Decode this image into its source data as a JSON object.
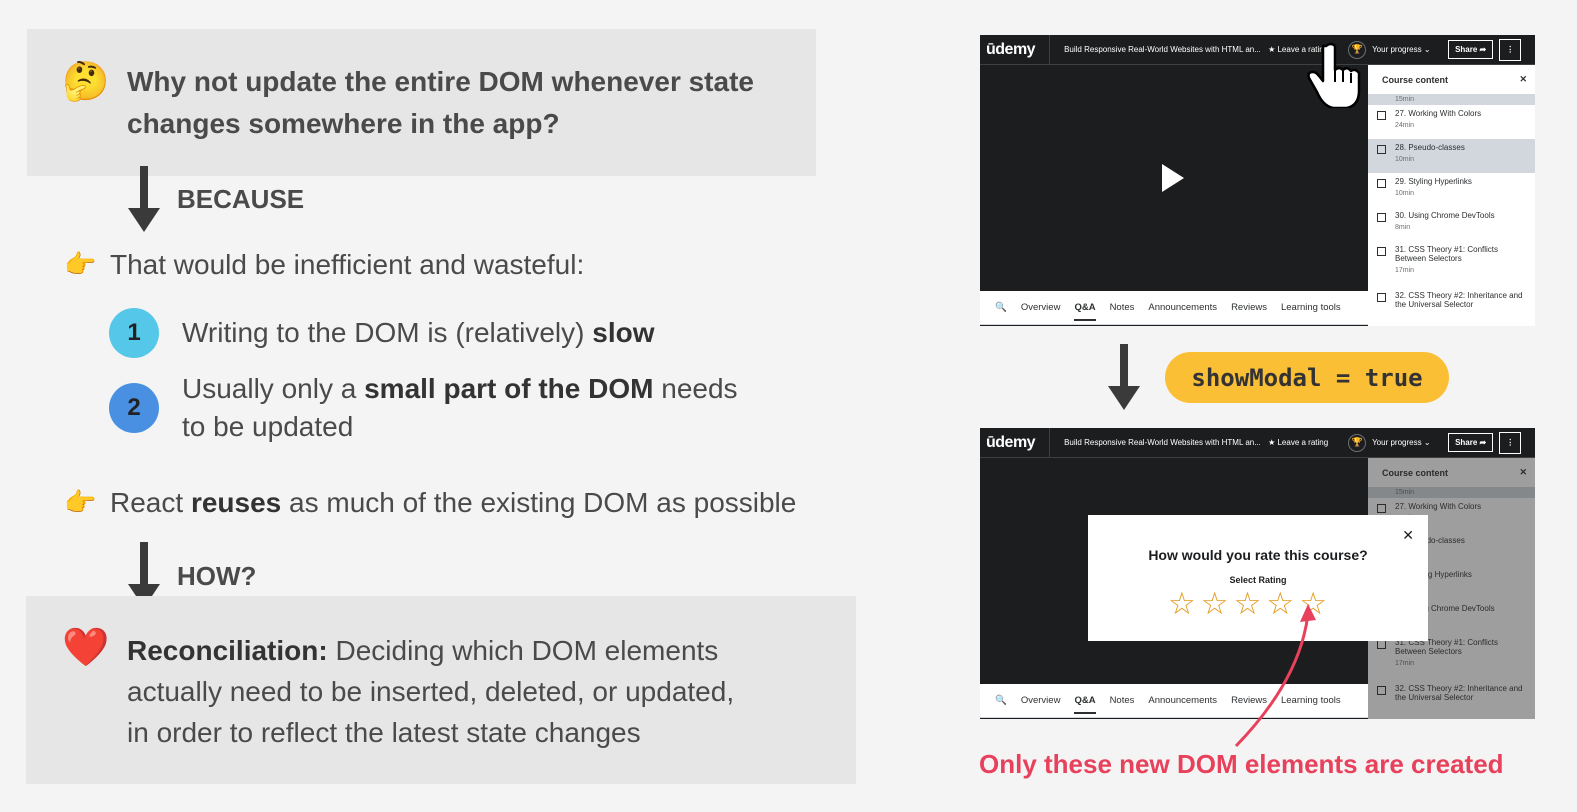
{
  "question": {
    "emoji": "🤔",
    "line1": "Why not update the entire DOM whenever state",
    "line2": "changes somewhere in the app?"
  },
  "because_label": "BECAUSE",
  "point1": {
    "bullet": "👉",
    "text": "That would be inefficient and wasteful:"
  },
  "items": [
    {
      "number": "1",
      "color": "#55c8ea",
      "pre": "Writing to the DOM is (relatively) ",
      "bold": "slow",
      "post": ""
    },
    {
      "number": "2",
      "color": "#4a90e2",
      "pre": "Usually only a ",
      "bold": "small part of the DOM",
      "post": " needs",
      "line2": "to be updated"
    }
  ],
  "point2": {
    "bullet": "👉",
    "pre": "React ",
    "bold": "reuses",
    "post": " as much of the existing DOM as possible"
  },
  "how_label": "HOW?",
  "reconciliation": {
    "emoji": "❤️",
    "bold": "Reconciliation:",
    "line1": " Deciding which DOM elements",
    "line2": "actually need to be inserted, deleted, or updated,",
    "line3": "in order to reflect the latest state changes"
  },
  "screenshot": {
    "logo": "ūdemy",
    "course_title": "Build Responsive Real-World Websites with HTML an...",
    "leave_rating": "★ Leave a rating",
    "your_progress": "Your progress ⌄",
    "share": "Share ➦",
    "more": "⋮",
    "sidebar_title": "Course content",
    "close": "✕",
    "top_duration": "15min",
    "lessons": [
      {
        "title": "27. Working With Colors",
        "duration": "24min",
        "highlight": false
      },
      {
        "title": "28. Pseudo-classes",
        "duration": "10min",
        "highlight": true
      },
      {
        "title": "29. Styling Hyperlinks",
        "duration": "10min",
        "highlight": false
      },
      {
        "title": "30. Using Chrome DevTools",
        "duration": "8min",
        "highlight": false
      },
      {
        "title": "31. CSS Theory #1: Conflicts Between Selectors",
        "duration": "17min",
        "highlight": false
      },
      {
        "title": "32. CSS Theory #2: Inheritance and the Universal Selector",
        "duration": "",
        "highlight": false
      }
    ],
    "tabs": [
      "🔍",
      "Overview",
      "Q&A",
      "Notes",
      "Announcements",
      "Reviews",
      "Learning tools"
    ]
  },
  "state_pill": "showModal = true",
  "modal": {
    "close": "✕",
    "title": "How would you rate this course?",
    "subtitle": "Select Rating",
    "stars": [
      "☆",
      "☆",
      "☆",
      "☆",
      "☆"
    ]
  },
  "caption": "Only these new DOM elements are created",
  "colors": {
    "box_bg": "#e6e6e6",
    "pill": "#fbbf36",
    "caption_red": "#e8415c"
  }
}
